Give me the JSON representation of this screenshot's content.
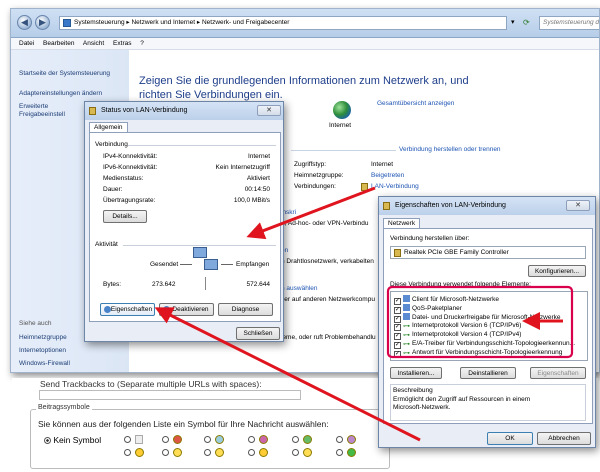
{
  "explorer": {
    "breadcrumb": [
      "Systemsteuerung",
      "Netzwerk und Internet",
      "Netzwerk- und Freigabecenter"
    ],
    "search_placeholder": "Systemsteuerung d",
    "menu": [
      "Datei",
      "Bearbeiten",
      "Ansicht",
      "Extras",
      "?"
    ],
    "left_links": [
      "Startseite der Systemsteuerung",
      "Adaptereinstellungen ändern",
      "Erweiterte Freigabeeinstell"
    ],
    "see_also_label": "Siehe auch",
    "see_also": [
      "Heimnetzgruppe",
      "Internetoptionen",
      "Windows-Firewall"
    ],
    "heading": "Zeigen Sie die grundlegenden Informationen zum Netzwerk an, und richten Sie Verbindungen ein.",
    "full_map_link": "Gesamtübersicht anzeigen",
    "internet_label": "Internet",
    "connect_link": "Verbindung herstellen oder trennen",
    "access_type_label": "Zugriffstyp:",
    "access_type_value": "Internet",
    "homegroup_label": "Heimnetzgruppe:",
    "homegroup_value": "Beigetreten",
    "connections_label": "Verbindungen:",
    "connections_value": "LAN-Verbindung",
    "frag1": "inskri",
    "frag2": "n, Ad-hoc- oder VPN-Verbindu",
    "frag3": "en",
    "frag4": "n Drahtlosnetzwerk, verkabelten",
    "frag5": "n auswählen",
    "frag6": "ker auf anderen Netzwerkcompu",
    "frag7": "leme, oder ruft Problembehandlu"
  },
  "status_dialog": {
    "title": "Status von LAN-Verbindung",
    "tab": "Allgemein",
    "section_connection": "Verbindung",
    "rows": [
      {
        "label": "IPv4-Konnektivität:",
        "value": "Internet"
      },
      {
        "label": "IPv6-Konnektivität:",
        "value": "Kein Internetzugriff"
      },
      {
        "label": "Medienstatus:",
        "value": "Aktiviert"
      },
      {
        "label": "Dauer:",
        "value": "00:14:50"
      },
      {
        "label": "Übertragungsrate:",
        "value": "100,0 MBit/s"
      }
    ],
    "details_button": "Details...",
    "section_activity": "Aktivität",
    "sent_label": "Gesendet",
    "received_label": "Empfangen",
    "bytes_label": "Bytes:",
    "bytes_sent": "273.642",
    "bytes_received": "572.644",
    "properties_button": "Eigenschaften",
    "deactivate_button": "Deaktivieren",
    "diagnose_button": "Diagnose",
    "close_button": "Schließen"
  },
  "props_dialog": {
    "title": "Eigenschaften von LAN-Verbindung",
    "tab": "Netzwerk",
    "connect_via_label": "Verbindung herstellen über:",
    "adapter": "Realtek PCIe GBE Family Controller",
    "configure_button": "Konfigurieren...",
    "items_label": "Diese Verbindung verwendet folgende Elemente:",
    "items": [
      "Client für Microsoft-Netzwerke",
      "QoS-Paketplaner",
      "Datei- und Druckerfreigabe für Microsoft-Netzwerke",
      "Internetprotokoll Version 6 (TCP/IPv6)",
      "Internetprotokoll Version 4 (TCP/IPv4)",
      "E/A-Treiber für Verbindungsschicht-Topologieerkennun...",
      "Antwort für Verbindungsschicht-Topologieerkennung"
    ],
    "install_button": "Installieren...",
    "uninstall_button": "Deinstallieren",
    "properties_button": "Eigenschaften",
    "description_label": "Beschreibung",
    "description": "Ermöglicht den Zugriff auf Ressourcen in einem Microsoft-Netzwerk.",
    "ok_button": "OK",
    "cancel_button": "Abbrechen"
  },
  "blog": {
    "trackback_label": "Send Trackbacks to (Separate multiple URLs with spaces):",
    "symbols_legend": "Beitragssymbole",
    "symbols_hint": "Sie können aus der folgenden Liste ein Symbol für Ihre Nachricht auswählen:",
    "no_symbol": "Kein Symbol"
  },
  "colors": {
    "arrow": "#e0141e",
    "highlight_box": "#d9004c",
    "link": "#1d54b3",
    "heading": "#1e3e8a"
  }
}
